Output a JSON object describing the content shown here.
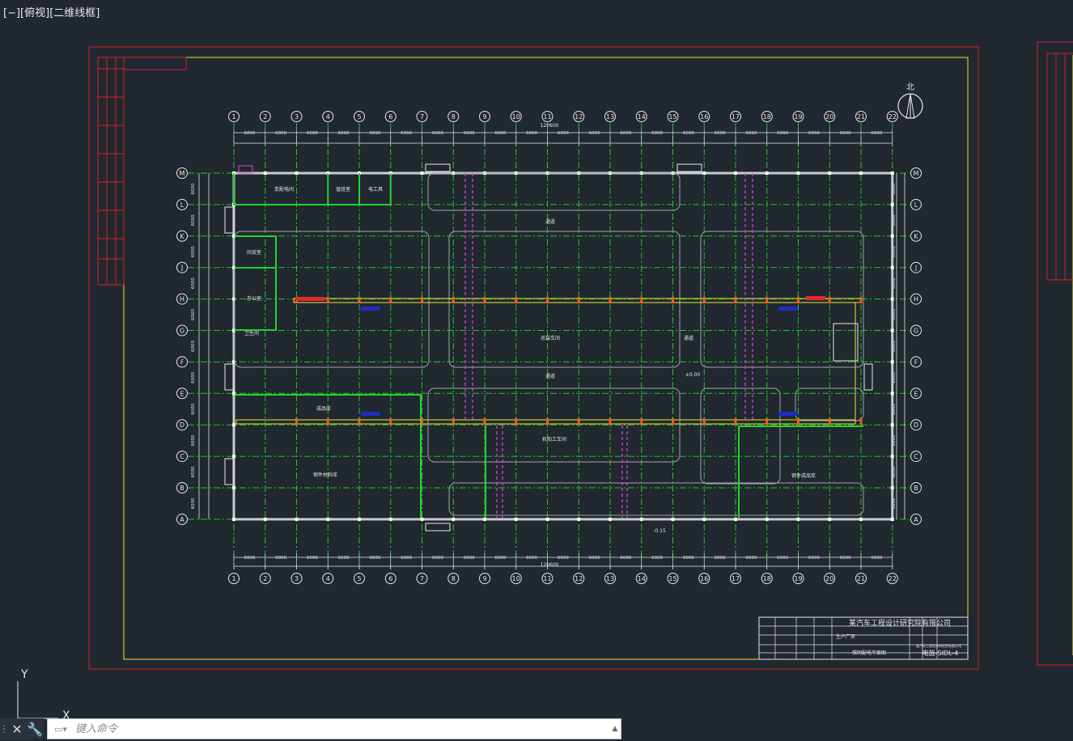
{
  "viewport": {
    "controls": "[−]",
    "view": "[俯视]",
    "style": "[二维线框]"
  },
  "ucs": {
    "y_label": "Y",
    "x_label": "X"
  },
  "compass": {
    "label": "北"
  },
  "grid": {
    "columns": [
      "1",
      "2",
      "3",
      "4",
      "5",
      "6",
      "7",
      "8",
      "9",
      "10",
      "11",
      "12",
      "13",
      "14",
      "15",
      "16",
      "17",
      "18",
      "19",
      "20",
      "21",
      "22"
    ],
    "rows": [
      "M",
      "L",
      "K",
      "J",
      "H",
      "G",
      "F",
      "E",
      "D",
      "C",
      "B",
      "A"
    ],
    "bay_dimension": "6000",
    "small_dimension": "300",
    "total_dimension": "120600",
    "right_dims": [
      "6000",
      "6000",
      "6000",
      "6000",
      "6000",
      "6000",
      "6000",
      "6000",
      "6000",
      "6000",
      "6000"
    ],
    "right_extra": [
      "1800",
      "4200",
      "3000"
    ]
  },
  "rooms": {
    "r1": "变配电间",
    "r2": "值班室",
    "r3": "电工具",
    "r4": "间谈室",
    "r5": "办公室",
    "r6": "卫生间",
    "road_top": "通道",
    "assembly": "总装车间",
    "aisle_right": "通道",
    "aisle_mid": "通道",
    "elevation": "±0.00",
    "storage": "成品库",
    "machining": "机加工车间",
    "raw_material": "钢件材料库",
    "finished": "钢件成品库",
    "outdoor_level": "-0.15"
  },
  "title_block": {
    "company": "某汽车工程设计研究院有限公司",
    "project": "生产厂房",
    "drawing_title": "照明配电平面图",
    "drawing_no": "电施-SIDL-4",
    "note": "某汽车工程设计研究院有限公司"
  },
  "command": {
    "placeholder": "键入命令"
  }
}
